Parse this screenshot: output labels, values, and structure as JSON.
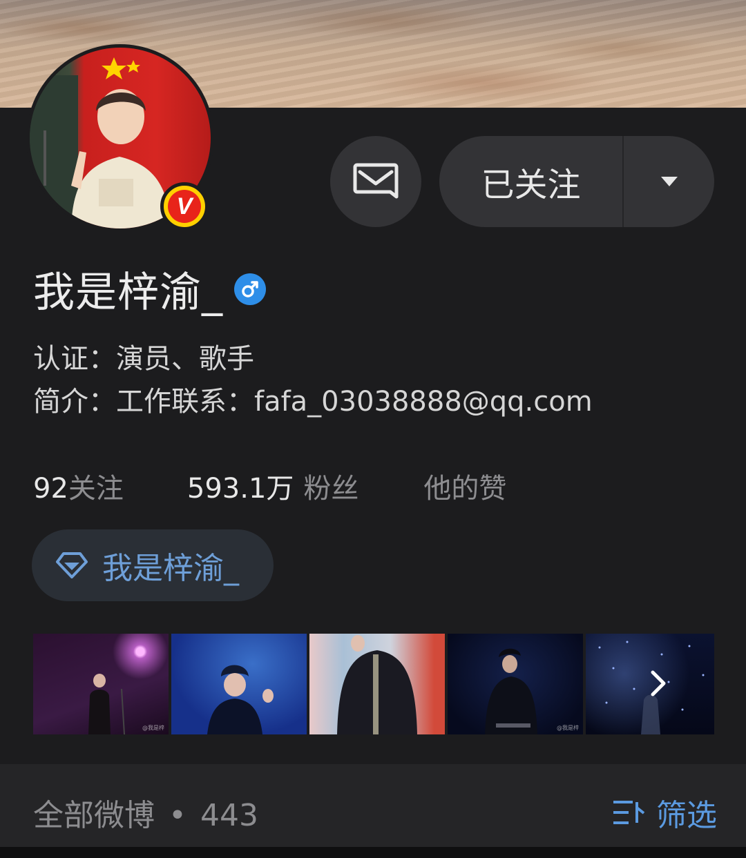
{
  "profile": {
    "name": "我是梓渝_",
    "verification": "认证：演员、歌手",
    "bio": "简介：工作联系：fafa_03038888@qq.com"
  },
  "actions": {
    "follow_label": "已关注"
  },
  "stats": {
    "following_count": "92",
    "following_label": "关注",
    "followers_count": "593.1万",
    "followers_label": "粉丝",
    "likes_label": "他的赞"
  },
  "supertopic": {
    "label": "我是梓渝_"
  },
  "posts": {
    "label": "全部微博",
    "separator": "•",
    "count": "443",
    "filter_label": "筛选"
  },
  "icons": {
    "message": "mail-icon",
    "dropdown": "caret-down-icon",
    "gender": "male-icon",
    "verified": "verified-v-icon",
    "supertopic": "diamond-icon",
    "filter": "filter-icon",
    "next": "chevron-right-icon"
  },
  "colors": {
    "background": "#1c1c1e",
    "button": "#333336",
    "accent": "#5b9ae0",
    "verified_badge": "#ffd000",
    "gender_badge": "#2e8ee8"
  }
}
